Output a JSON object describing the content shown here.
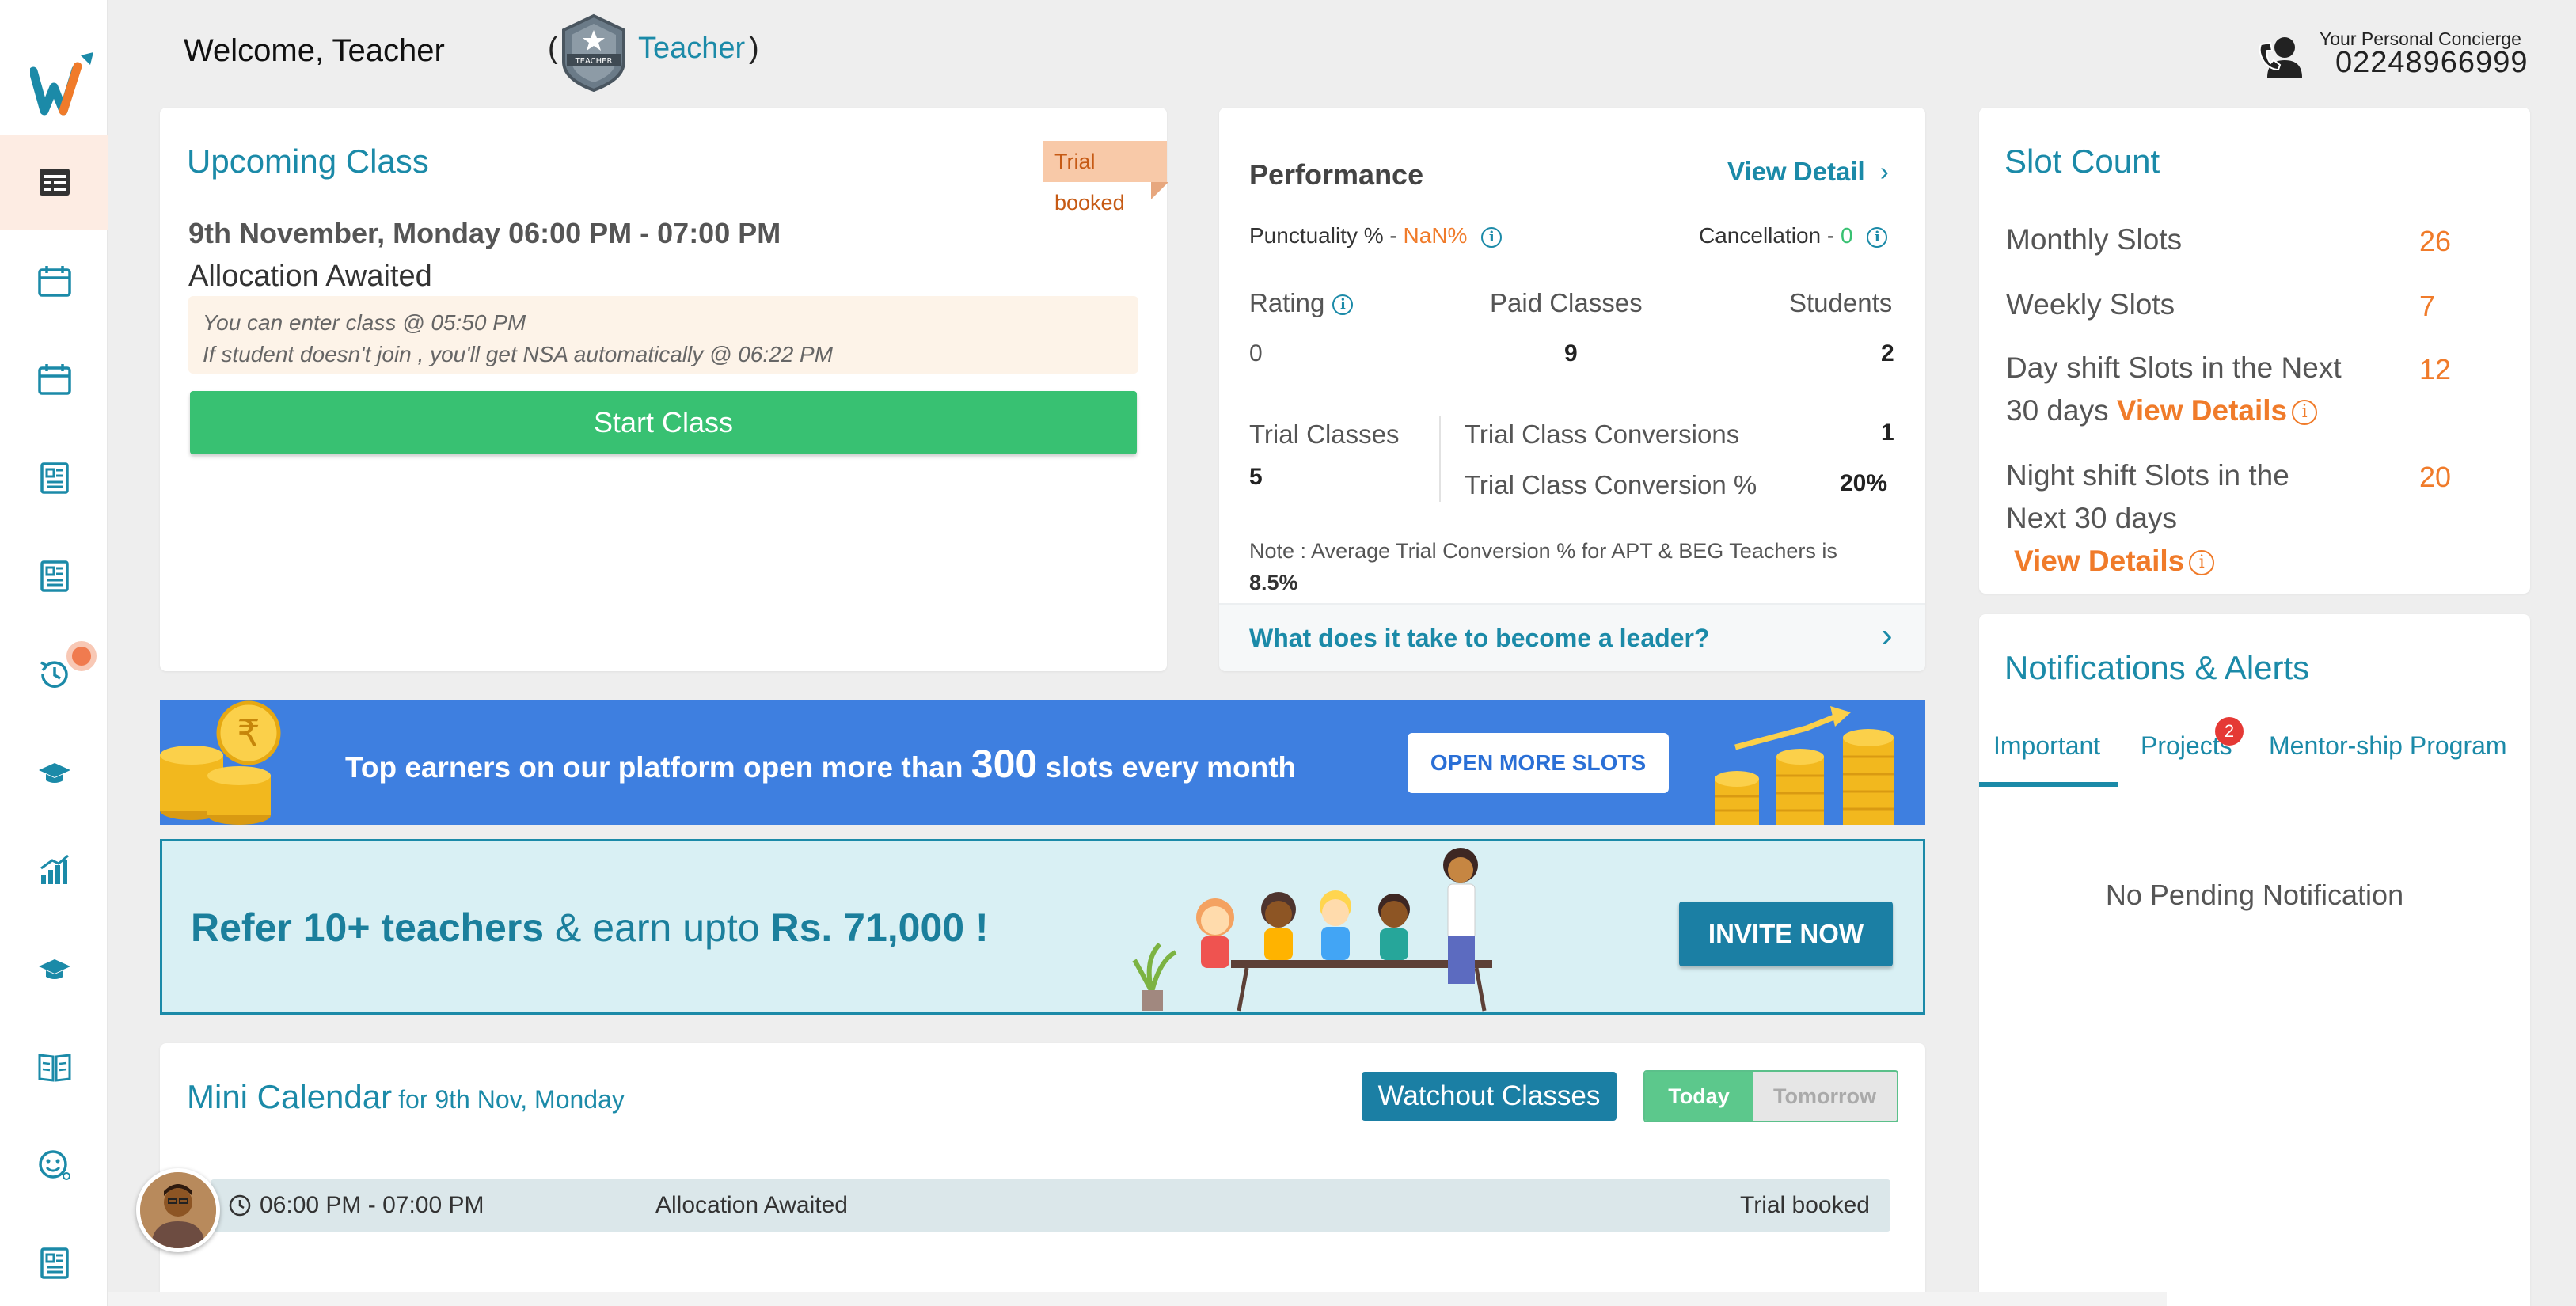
{
  "header": {
    "welcome": "Welcome, Teacher",
    "paren_open": "(",
    "role_link": "Teacher",
    "paren_close": ")",
    "badge_text": "TEACHER",
    "concierge_label": "Your Personal Concierge",
    "concierge_phone": "02248966999"
  },
  "sidebar": {
    "icons": [
      "dashboard-icon",
      "calendar-icon",
      "calendar-icon",
      "document-icon",
      "document-icon",
      "history-icon",
      "graduation-cap-icon",
      "bar-chart-icon",
      "graduation-cap-icon",
      "book-icon",
      "emoji-icon",
      "document-icon"
    ]
  },
  "upcoming": {
    "title": "Upcoming Class",
    "ribbon": "Trial booked",
    "time": "9th November, Monday 06:00 PM - 07:00 PM",
    "allocation": "Allocation Awaited",
    "note_line1": "You can enter class @ 05:50 PM",
    "note_line2": "If student doesn't join , you'll get NSA automatically @ 06:22 PM",
    "start_button": "Start Class"
  },
  "performance": {
    "title": "Performance",
    "view_detail": "View Detail",
    "punctuality_label": "Punctuality % -",
    "punctuality_value": "NaN%",
    "cancellation_label": "Cancellation -",
    "cancellation_value": "0",
    "rating_label": "Rating",
    "rating_value": "0",
    "paid_label": "Paid Classes",
    "paid_value": "9",
    "students_label": "Students",
    "students_value": "2",
    "trial_label": "Trial Classes",
    "trial_value": "5",
    "conversions_label": "Trial Class Conversions",
    "conversions_value": "1",
    "conversion_pct_label": "Trial Class Conversion %",
    "conversion_pct_value": "20%",
    "note_text": "Note : Average Trial Conversion % for APT & BEG Teachers is",
    "note_value": "8.5%",
    "leader_link": "What does it take to become a leader?",
    "colors": {
      "accent": "#1b8aa8",
      "orange": "#f07b2a",
      "green": "#38c172"
    }
  },
  "slots": {
    "title": "Slot Count",
    "monthly_label": "Monthly Slots",
    "monthly_value": "26",
    "weekly_label": "Weekly Slots",
    "weekly_value": "7",
    "day_label_1": "Day shift Slots in the Next",
    "day_label_2": "30 days",
    "day_link": "View Details",
    "day_value": "12",
    "night_label_1": "Night shift Slots in the",
    "night_label_2": "Next 30 days",
    "night_link": "View Details",
    "night_value": "20"
  },
  "notifications": {
    "title": "Notifications & Alerts",
    "tabs": [
      "Important",
      "Projects",
      "Mentor-ship Program"
    ],
    "projects_badge": "2",
    "empty_text": "No Pending Notification"
  },
  "promo": {
    "text_before": "Top earners on our platform open more than",
    "number": "300",
    "text_after": "slots every month",
    "button": "OPEN MORE SLOTS",
    "currency_symbol": "₹"
  },
  "refer": {
    "bold1": "Refer 10+ teachers",
    "middle": "& earn upto",
    "bold2": "Rs. 71,000 !",
    "button": "INVITE NOW"
  },
  "mini_calendar": {
    "title": "Mini Calendar",
    "subtitle": "for 9th Nov, Monday",
    "watchout_button": "Watchout Classes",
    "today": "Today",
    "tomorrow": "Tomorrow",
    "row": {
      "time": "06:00 PM - 07:00 PM",
      "status": "Allocation Awaited",
      "type": "Trial booked"
    }
  }
}
